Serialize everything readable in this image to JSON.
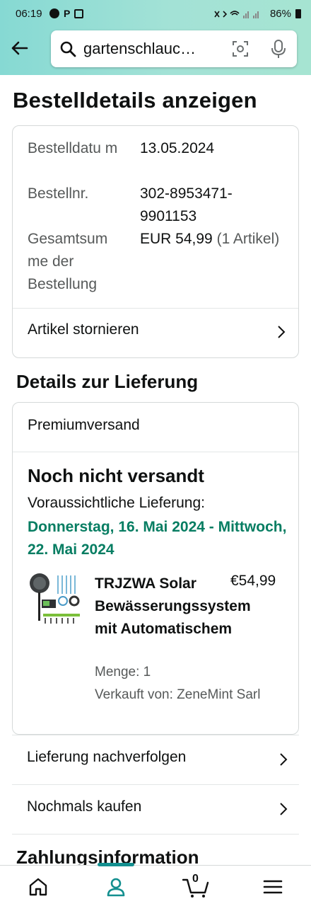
{
  "status_bar": {
    "time": "06:19",
    "battery": "86%"
  },
  "header": {
    "search_value": "gartenschlauc…",
    "icons": [
      "back-arrow-icon",
      "search-icon",
      "camera-scan-icon",
      "microphone-icon"
    ]
  },
  "page_title": "Bestelldetails anzeigen",
  "order_summary": {
    "date_label": "Bestelldatu m",
    "date_value": "13.05.2024",
    "number_label": "Bestellnr.",
    "number_value": "302-8953471-9901153",
    "total_label": "Gesamtsum me der Bestellung",
    "total_value": "EUR 54,99",
    "total_count": "(1 Artikel)",
    "cancel_label": "Artikel stornieren"
  },
  "delivery": {
    "section_title": "Details zur Lieferung",
    "shipping_method": "Premiumversand",
    "status": "Noch nicht versandt",
    "expected_label": "Voraussichtliche Lieferung:",
    "expected_range": "Donnerstag, 16. Mai 2024 - Mittwoch, 22. Mai 2024",
    "item": {
      "name": "TRJZWA Solar Bewässerungssystem mit Automatischem",
      "price": "€54,99",
      "quantity": "Menge: 1",
      "seller": "Verkauft von: ZeneMint Sarl"
    }
  },
  "actions": {
    "track": "Lieferung nachverfolgen",
    "rebuy": "Nochmals kaufen"
  },
  "payment_title": "Zahlungsinformation",
  "bottom_nav": {
    "cart_count": "0",
    "items": [
      "home-icon",
      "account-icon",
      "cart-icon",
      "menu-icon"
    ]
  },
  "colors": {
    "header_gradient_start": "#86d9d3",
    "delivery_green": "#067d62",
    "nav_accent": "#138f8f"
  }
}
